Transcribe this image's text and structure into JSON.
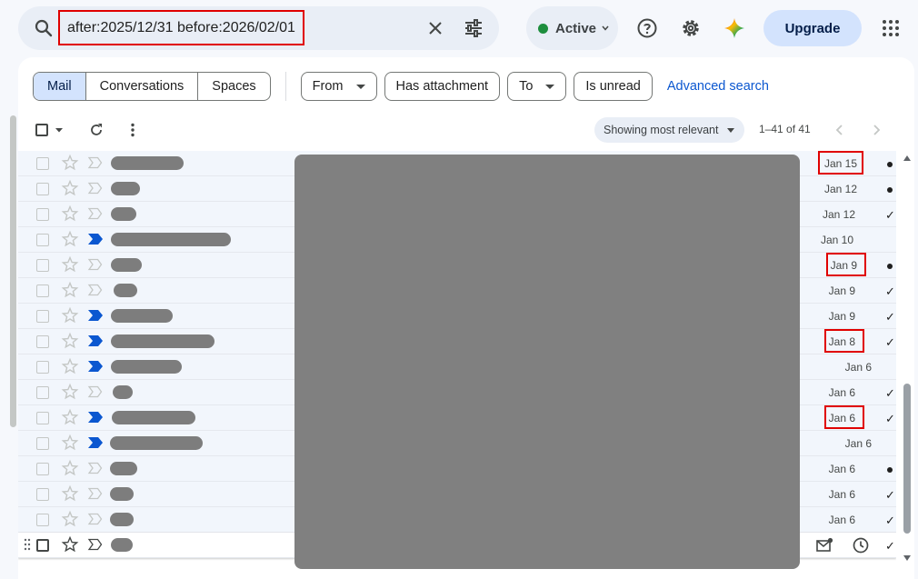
{
  "search": {
    "query": "after:2025/12/31 before:2026/02/01"
  },
  "status": {
    "label": "Active",
    "color": "#1e8e3e"
  },
  "header": {
    "upgrade_label": "Upgrade"
  },
  "filters": {
    "tabs": [
      {
        "label": "Mail",
        "selected": true
      },
      {
        "label": "Conversations"
      },
      {
        "label": "Spaces"
      }
    ],
    "from_label": "From",
    "has_attachment_label": "Has attachment",
    "to_label": "To",
    "is_unread_label": "Is unread",
    "advanced_search_label": "Advanced search"
  },
  "toolbar": {
    "sort_label": "Showing most relevant",
    "count": "1–41 of 41"
  },
  "rows": [
    {
      "date": "Jan 15",
      "highlight": true,
      "important": false,
      "status": "dot"
    },
    {
      "date": "Jan 12",
      "highlight": false,
      "important": false,
      "status": "dot"
    },
    {
      "date": "Jan 12",
      "highlight": false,
      "important": false,
      "status": "check"
    },
    {
      "date": "Jan 10",
      "highlight": false,
      "important": true,
      "status": "none"
    },
    {
      "date": "Jan 9",
      "highlight": true,
      "important": false,
      "status": "dot"
    },
    {
      "date": "Jan 9",
      "highlight": false,
      "important": false,
      "status": "check"
    },
    {
      "date": "Jan 9",
      "highlight": false,
      "important": true,
      "status": "check"
    },
    {
      "date": "Jan 8",
      "highlight": true,
      "important": true,
      "status": "check"
    },
    {
      "date": "Jan 6",
      "highlight": false,
      "important": true,
      "status": "none"
    },
    {
      "date": "Jan 6",
      "highlight": false,
      "important": false,
      "status": "check"
    },
    {
      "date": "Jan 6",
      "highlight": true,
      "important": true,
      "status": "check"
    },
    {
      "date": "Jan 6",
      "highlight": false,
      "important": true,
      "status": "none"
    },
    {
      "date": "Jan 6",
      "highlight": false,
      "important": false,
      "status": "dot"
    },
    {
      "date": "Jan 6",
      "highlight": false,
      "important": false,
      "status": "check"
    },
    {
      "date": "Jan 6",
      "highlight": false,
      "important": false,
      "status": "check"
    },
    {
      "date": "",
      "highlight": false,
      "important": false,
      "status": "check",
      "hover": true
    }
  ],
  "colors": {
    "accent": "#0b57d0",
    "highlight_box": "#e00000",
    "selected_chip": "#d3e3fd"
  }
}
